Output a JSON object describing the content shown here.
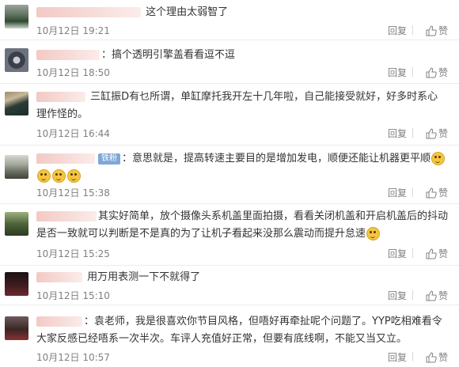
{
  "comments": [
    {
      "user_w": 132,
      "text": "这个理由太弱智了",
      "time": "10月12日 19:21",
      "reply": "回复",
      "like": "赞",
      "avatar_color": "#2f4a32"
    },
    {
      "user_w": 80,
      "text": "：搞个透明引擎盖看看逗不逗",
      "time": "10月12日 18:50",
      "reply": "回复",
      "like": "赞",
      "avatar_color": "#555a66"
    },
    {
      "user_w": 62,
      "text": "三缸振D有乜所谓，单缸摩托我开左十几年啦，自己能接受就好，好多时系心理作怪的。",
      "time": "10月12日 16:44",
      "reply": "回复",
      "like": "赞",
      "avatar_color": "#1d2d2a"
    },
    {
      "user_w": 74,
      "badge": "铁粉",
      "text": "：意思就是，提高转速主要目的是增加发电，顺便还能让机器更平顺",
      "emojis": 4,
      "time": "10月12日 15:38",
      "reply": "回复",
      "like": "赞",
      "avatar_color": "#6a6f63"
    },
    {
      "user_w": 76,
      "text": "其实好简单，放个摄像头系机盖里面拍摄，看看关闭机盖和开启机盖后的抖动是否一致就可以判断是不是真的为了让机子看起来没那么震动而提升怠速",
      "emojis": 1,
      "time": "10月12日 15:25",
      "reply": "回复",
      "like": "赞",
      "avatar_color": "#2b3a20"
    },
    {
      "user_w": 58,
      "text": "用万用表测一下不就得了",
      "time": "10月12日 15:10",
      "reply": "回复",
      "like": "赞",
      "avatar_color": "#3a1a1e"
    },
    {
      "user_w": 58,
      "text": "：袁老师，我是很喜欢你节目风格，但唔好再牵扯呢个问题了。YYP吃相难看令大家反感已经唔系一次半次。车评人充值好正常，但要有底线啊，不能又当又立。",
      "time": "10月12日 10:57",
      "reply": "回复",
      "like": "赞",
      "avatar_color": "#3b2626"
    }
  ]
}
